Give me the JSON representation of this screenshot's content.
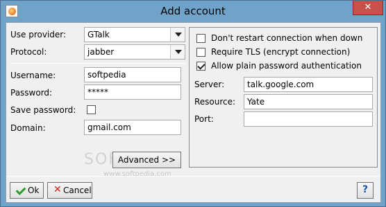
{
  "window": {
    "title": "Add account",
    "close_label": "✕"
  },
  "left": {
    "provider_label": "Use provider:",
    "provider_value": "GTalk",
    "protocol_label": "Protocol:",
    "protocol_value": "jabber",
    "username_label": "Username:",
    "username_value": "softpedia",
    "password_label": "Password:",
    "password_value": "*****",
    "save_password_label": "Save password:",
    "save_password_checked": false,
    "domain_label": "Domain:",
    "domain_value": "gmail.com",
    "advanced_label": "Advanced >>"
  },
  "right": {
    "dont_restart_label": "Don't restart connection when down",
    "dont_restart_checked": false,
    "require_tls_label": "Require TLS (encrypt connection)",
    "require_tls_checked": false,
    "allow_plain_label": "Allow plain password authentication",
    "allow_plain_checked": true,
    "server_label": "Server:",
    "server_value": "talk.google.com",
    "resource_label": "Resource:",
    "resource_value": "Yate",
    "port_label": "Port:",
    "port_value": ""
  },
  "footer": {
    "ok_label": "Ok",
    "cancel_label": "Cancel",
    "help_label": "?"
  },
  "watermark": {
    "text": "SOFTPEDIA",
    "url": "www.softpedia.com"
  }
}
